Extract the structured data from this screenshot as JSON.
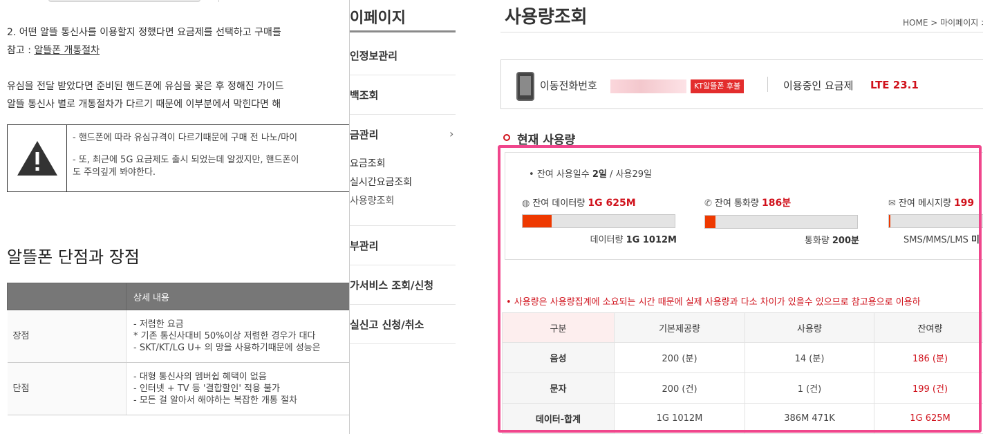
{
  "blog": {
    "step2_line1": "2. 어떤 알뜰 통신사를 이용할지 정했다면 요금제를 선택하고 구매를",
    "ref_prefix": "참고 : ",
    "ref_link": "알뜰폰 개통절차",
    "para_line1": "유심을 전달 받았다면 준비된 핸드폰에 유심을 꽂은 후 정해진 가이드",
    "para_line2": "알뜰 통신사 별로 개통절차가 다르기 때문에 이부분에서 막힌다면 해",
    "warning_line1": "- 핸드폰에 따라 유심규격이 다르기때문에 구매 전 나노/마이",
    "warning_line2": "- 또, 최근에 5G 요금제도 출시 되었는데 알겠지만, 핸드폰이",
    "warning_line3": "도 주의깊게 봐야한다.",
    "section_title": "알뜰폰 단점과 장점",
    "table_header_detail": "상세 내용",
    "rows": [
      {
        "label": "장점",
        "lines": [
          "- 저렴한 요금",
          "* 기존 통신사대비 50%이상 저렴한 경우가 대다",
          "- SKT/KT/LG U+ 의 망을 사용하기때문에 성능은"
        ]
      },
      {
        "label": "단점",
        "lines": [
          "- 대형 통신사의 멤버쉽 혜택이 없음",
          "- 인터넷 + TV 등 '결합할인' 적용 불가",
          "- 모든 걸 알아서 해야하는 복잡한 개통 절차"
        ]
      }
    ]
  },
  "sidebar": {
    "title": "이페이지",
    "items": [
      {
        "label": "인정보관리"
      },
      {
        "label": "백조회"
      },
      {
        "label": "금관리"
      },
      {
        "label": "부관리"
      },
      {
        "label": "가서비스 조회/신청"
      },
      {
        "label": "실신고 신청/취소"
      }
    ],
    "sub_items": [
      {
        "label": "요금조회"
      },
      {
        "label": "실시간요금조회"
      },
      {
        "label": "사용량조회"
      }
    ],
    "chevron": "›"
  },
  "main": {
    "title": "사용량조회",
    "breadcrumb": "HOME > 마이페이지 >",
    "line_label": "이동전화번호",
    "line_badge": "KT알뜰폰 후불",
    "plan_label": "이용중인 요금제",
    "plan_value": "LTE 23.1",
    "section_title": "현재 사용량",
    "days_prefix": "잔여 사용일수 ",
    "days_remaining": "2일",
    "days_sep": " / 사용",
    "days_used": "29일",
    "meters": [
      {
        "icon": "globe-icon",
        "glyph": "◍",
        "label": "잔여 데이터량 ",
        "value": "1G 625M",
        "total_label": "데이터량 ",
        "total_value": "1G 1012M",
        "fill": 0.19,
        "color": "#ee3900"
      },
      {
        "icon": "phone-icon",
        "glyph": "✆",
        "label": "잔여 통화량 ",
        "value": "186분",
        "total_label": "통화량 ",
        "total_value": "200분",
        "fill": 0.07,
        "color": "#ee3900"
      },
      {
        "icon": "mail-icon",
        "glyph": "✉",
        "label": "잔여 메시지량 ",
        "value": "199",
        "total_label": "SMS/MMS/LMS ",
        "total_value": "미",
        "fill": 0.01,
        "color": "#ee3900"
      }
    ],
    "notice": "• 사용량은 사용량집계에 소요되는 시간 때문에 실제 사용량과 다소 차이가 있을수 있으므로 참고용으로 이용하",
    "table": {
      "headers": [
        "구분",
        "기본제공량",
        "사용량",
        "잔여량"
      ],
      "rows": [
        [
          "음성",
          "200 (분)",
          "14 (분)",
          "186 (분)"
        ],
        [
          "문자",
          "200 (건)",
          "1 (건)",
          "199 (건)"
        ],
        [
          "데이터-합계",
          "1G 1012M",
          "386M 471K",
          "1G 625M"
        ]
      ]
    }
  }
}
